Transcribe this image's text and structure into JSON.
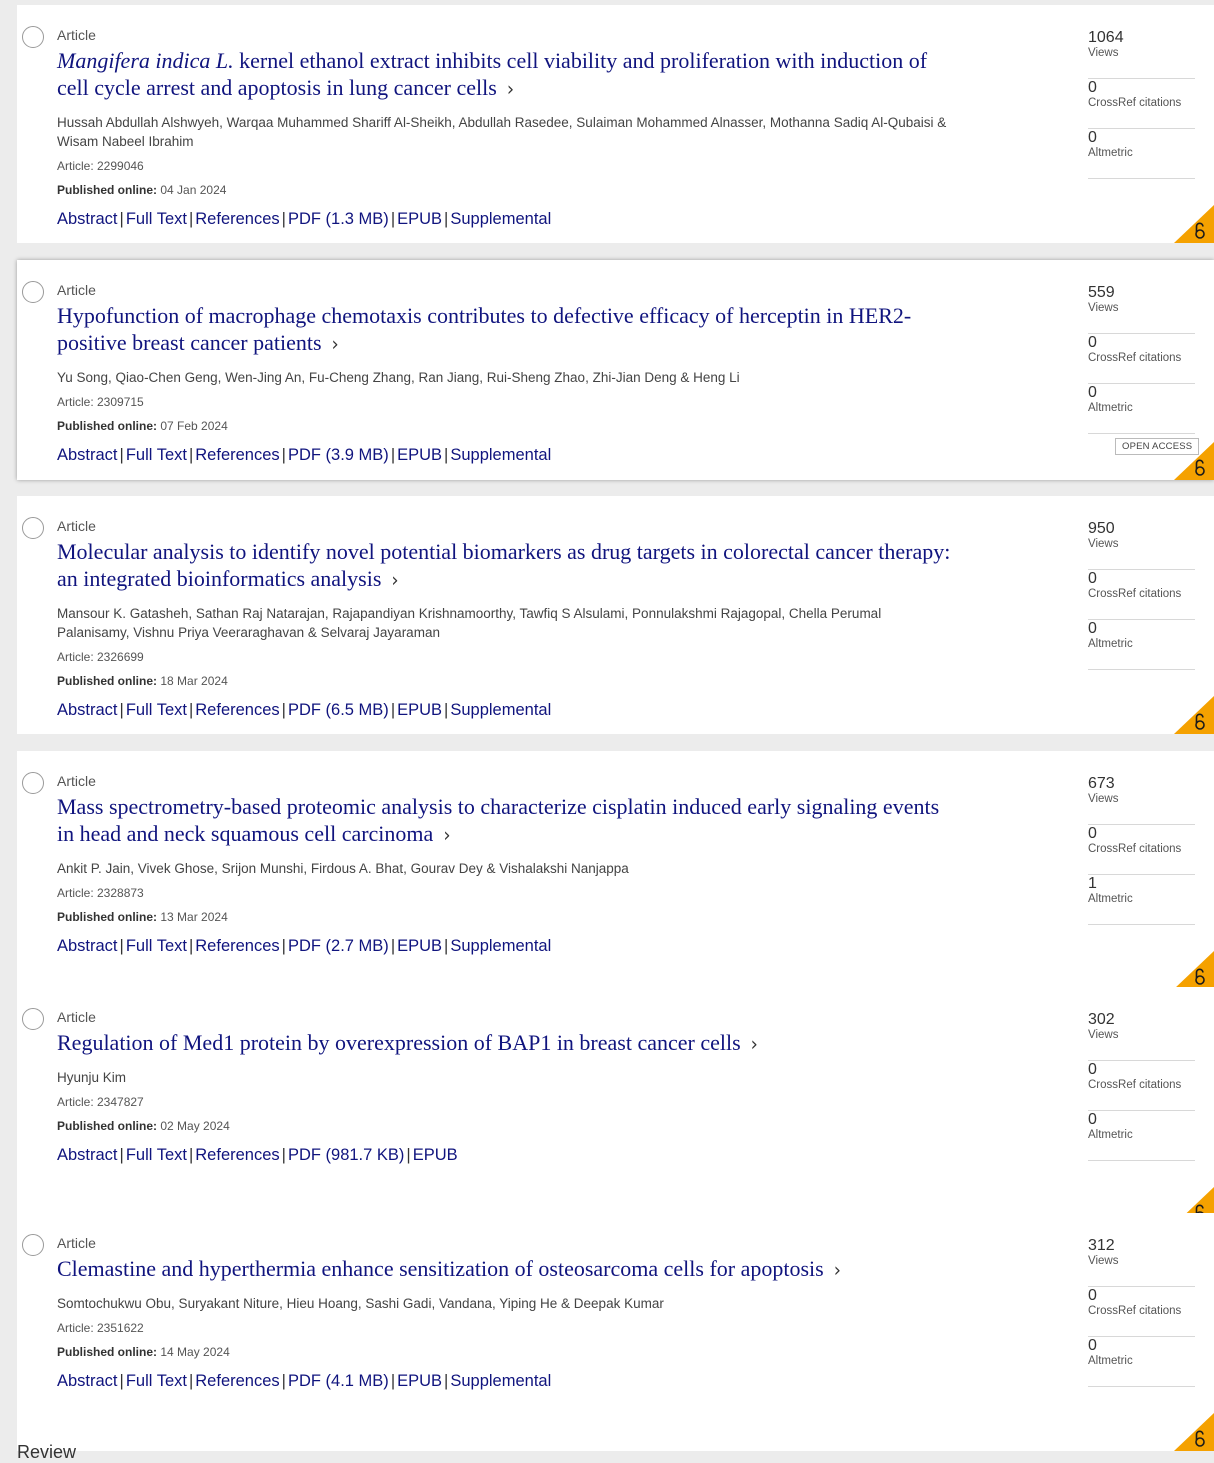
{
  "labels": {
    "views": "Views",
    "crossref": "CrossRef citations",
    "altmetric": "Altmetric",
    "abstract": "Abstract",
    "full_text": "Full Text",
    "references": "References",
    "epub": "EPUB",
    "supplemental": "Supplemental",
    "published_online": "Published online:",
    "open_access": "OPEN ACCESS",
    "separator": "|",
    "chevron": "›"
  },
  "colors": {
    "title": "#10147e",
    "open_access_badge": "#f5a100",
    "background": "#ececec"
  },
  "icons": {
    "checkbox": "select-circle-icon",
    "chevron": "chevron-right-icon",
    "open_access": "open-lock-icon"
  },
  "articles": [
    {
      "type": "Article",
      "title_italic": "Mangifera indica L.",
      "title": " kernel ethanol extract inhibits cell viability and proliferation with induction of cell cycle arrest and apoptosis in lung cancer cells",
      "authors": "Hussah Abdullah Alshwyeh, Warqaa Muhammed Shariff Al-Sheikh, Abdullah Rasedee, Sulaiman Mohammed Alnasser, Mothanna Sadiq Al-Qubaisi & Wisam Nabeel Ibrahim",
      "article_no": "Article: 2299046",
      "published": "04 Jan 2024",
      "pdf": "PDF (1.3 MB)",
      "has_supplemental": true,
      "views": "1064",
      "crossref": "0",
      "altmetric": "0",
      "open_access_tag": false
    },
    {
      "type": "Article",
      "title_italic": "",
      "title": "Hypofunction of macrophage chemotaxis contributes to defective efficacy of herceptin in HER2-positive breast cancer patients",
      "authors": "Yu Song, Qiao-Chen Geng, Wen-Jing An, Fu-Cheng Zhang, Ran Jiang, Rui-Sheng Zhao, Zhi-Jian Deng & Heng Li",
      "article_no": "Article: 2309715",
      "published": "07 Feb 2024",
      "pdf": "PDF (3.9 MB)",
      "has_supplemental": true,
      "views": "559",
      "crossref": "0",
      "altmetric": "0",
      "open_access_tag": true
    },
    {
      "type": "Article",
      "title_italic": "",
      "title": "Molecular analysis to identify novel potential biomarkers as drug targets in colorectal cancer therapy: an integrated bioinformatics analysis",
      "authors": "Mansour K. Gatasheh, Sathan Raj Natarajan, Rajapandiyan Krishnamoorthy, Tawfiq S Alsulami, Ponnulakshmi Rajagopal, Chella Perumal Palanisamy, Vishnu Priya Veeraraghavan & Selvaraj Jayaraman",
      "article_no": "Article: 2326699",
      "published": "18 Mar 2024",
      "pdf": "PDF (6.5 MB)",
      "has_supplemental": true,
      "views": "950",
      "crossref": "0",
      "altmetric": "0",
      "open_access_tag": false
    },
    {
      "type": "Article",
      "title_italic": "",
      "title": "Mass spectrometry-based proteomic analysis to characterize cisplatin induced early signaling events in head and neck squamous cell carcinoma",
      "authors": "Ankit P. Jain, Vivek Ghose, Srijon Munshi, Firdous A. Bhat, Gourav Dey & Vishalakshi Nanjappa",
      "article_no": "Article: 2328873",
      "published": "13 Mar 2024",
      "pdf": "PDF (2.7 MB)",
      "has_supplemental": true,
      "views": "673",
      "crossref": "0",
      "altmetric": "1",
      "open_access_tag": false
    },
    {
      "type": "Article",
      "title_italic": "",
      "title": "Regulation of Med1 protein by overexpression of BAP1 in breast cancer cells",
      "authors": "Hyunju Kim",
      "article_no": "Article: 2347827",
      "published": "02 May 2024",
      "pdf": "PDF (981.7 KB)",
      "has_supplemental": false,
      "views": "302",
      "crossref": "0",
      "altmetric": "0",
      "open_access_tag": false
    },
    {
      "type": "Article",
      "title_italic": "",
      "title": "Clemastine and hyperthermia enhance sensitization of osteosarcoma cells for apoptosis",
      "authors": "Somtochukwu Obu, Suryakant Niture, Hieu Hoang, Sashi Gadi, Vandana, Yiping He & Deepak Kumar",
      "article_no": "Article: 2351622",
      "published": "14 May 2024",
      "pdf": "PDF (4.1 MB)",
      "has_supplemental": true,
      "views": "312",
      "crossref": "0",
      "altmetric": "0",
      "open_access_tag": false
    }
  ],
  "next_section": "Review"
}
